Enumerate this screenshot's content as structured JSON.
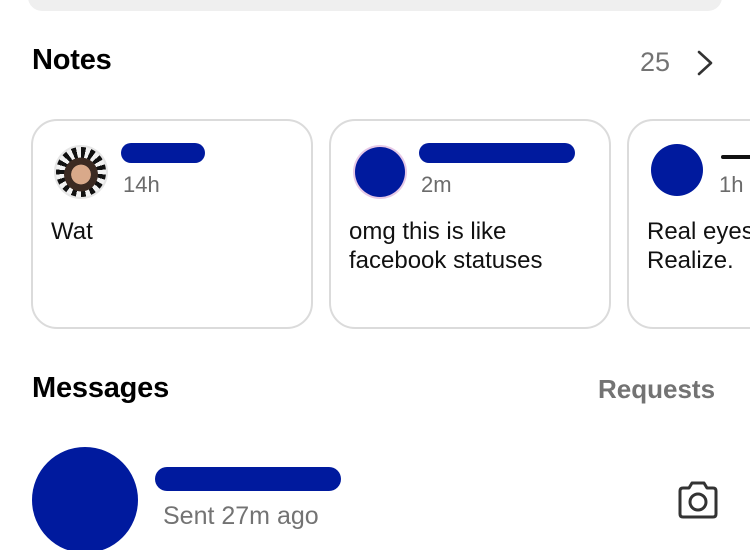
{
  "notes": {
    "title": "Notes",
    "count": "25",
    "cards": [
      {
        "time": "14h",
        "text": "Wat"
      },
      {
        "time": "2m",
        "text": "omg this is like\nfacebook statuses"
      },
      {
        "time": "1h",
        "text": "Real eyes\nRealize."
      }
    ]
  },
  "messages": {
    "title": "Messages",
    "requests_label": "Requests",
    "items": [
      {
        "status": "Sent 27m ago"
      }
    ]
  },
  "colors": {
    "redaction": "#001a9e",
    "secondary_text": "#737373",
    "card_border": "#dbdbdb"
  }
}
